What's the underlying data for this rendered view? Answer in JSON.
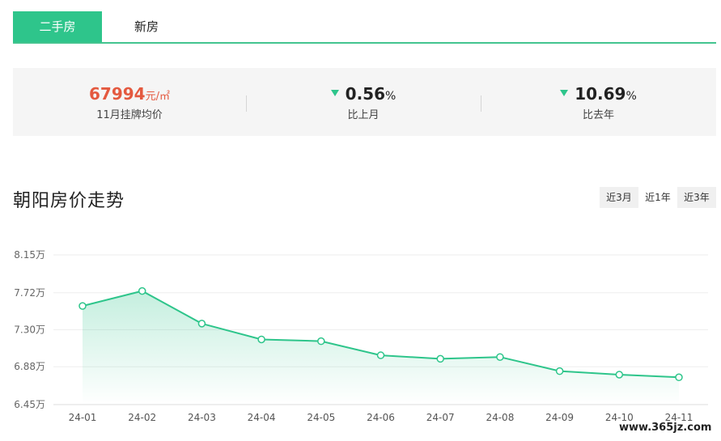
{
  "tabs": [
    {
      "label": "二手房",
      "active": true
    },
    {
      "label": "新房",
      "active": false
    }
  ],
  "stats": {
    "price": {
      "value": "67994",
      "unit": "元/㎡",
      "label": "11月挂牌均价"
    },
    "mom": {
      "value": "0.56",
      "unit": "%",
      "label": "比上月",
      "direction": "down"
    },
    "yoy": {
      "value": "10.69",
      "unit": "%",
      "label": "比去年",
      "direction": "down"
    }
  },
  "chart_title": "朝阳房价走势",
  "ranges": [
    {
      "label": "近3月",
      "active": false
    },
    {
      "label": "近1年",
      "active": true
    },
    {
      "label": "近3年",
      "active": false
    }
  ],
  "watermark": "www.365jz.com",
  "colors": {
    "accent": "#2ec58b",
    "price": "#e4593f",
    "grid": "#eeeeee"
  },
  "chart_data": {
    "type": "area",
    "categories": [
      "24-01",
      "24-02",
      "24-03",
      "24-04",
      "24-05",
      "24-06",
      "24-07",
      "24-08",
      "24-09",
      "24-10",
      "24-11"
    ],
    "values": [
      7.57,
      7.74,
      7.37,
      7.19,
      7.17,
      7.01,
      6.97,
      6.99,
      6.83,
      6.79,
      6.76
    ],
    "y_ticks": [
      "8.15万",
      "7.72万",
      "7.30万",
      "6.88万",
      "6.45万"
    ],
    "y_tick_values": [
      8.15,
      7.72,
      7.3,
      6.88,
      6.45
    ],
    "ylim": [
      6.45,
      8.15
    ],
    "grid": true
  }
}
